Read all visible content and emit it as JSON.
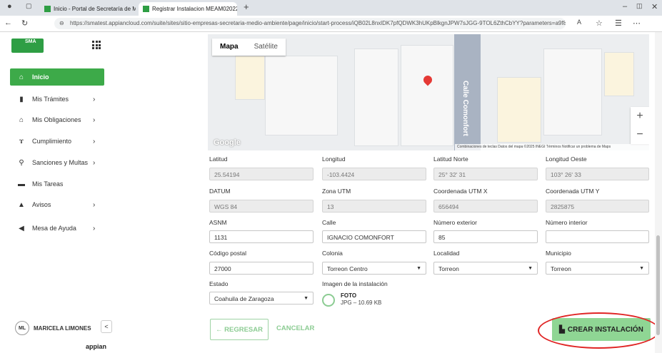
{
  "browser": {
    "tabs": [
      {
        "label": "Inicio - Portal de Secretaría de M "
      },
      {
        "label": "Registrar Instalacion MEAM02022"
      }
    ],
    "new_tab": "+",
    "url": "https://smatest.appiancloud.com/suite/sites/sitio-empresas-secretaria-medio-ambiente/page/inicio/start-process/iQB02L8nxlDK7pfQDWK3hUKpBlkgnJPW7sJGG-9TOL6ZthCbYY?parameters=a9f81..."
  },
  "sidebar": {
    "logo_text": "SMA",
    "items": [
      {
        "label": "Inicio",
        "icon": "home-icon",
        "glyph": "⌂"
      },
      {
        "label": "Mis Trámites",
        "icon": "document-icon",
        "glyph": "▮"
      },
      {
        "label": "Mis Obligaciones",
        "icon": "institution-icon",
        "glyph": "⌂"
      },
      {
        "label": "Cumplimiento",
        "icon": "award-icon",
        "glyph": "ɤ"
      },
      {
        "label": "Sanciones y Multas",
        "icon": "search-person-icon",
        "glyph": "⚲"
      },
      {
        "label": "Mis Tareas",
        "icon": "briefcase-icon",
        "glyph": "▬"
      },
      {
        "label": "Avisos",
        "icon": "warning-icon",
        "glyph": "▲"
      },
      {
        "label": "Mesa de Ayuda",
        "icon": "megaphone-icon",
        "glyph": "◀"
      }
    ],
    "chevron": "›",
    "user_initials": "ML",
    "user_name": "MARICELA LIMONES",
    "collapse": "<",
    "footer": "appian"
  },
  "map": {
    "tab_map": "Mapa",
    "tab_satellite": "Satélite",
    "street": "Calle Comonfort",
    "zoom_in": "+",
    "zoom_out": "−",
    "google": "Google",
    "attribution": "Combinaciones de teclas   Datos del mapa ©2025 INEGI   Términos   Notificar un problema de Maps"
  },
  "form": {
    "latitud": {
      "label": "Latitud",
      "value": "25.54194"
    },
    "longitud": {
      "label": "Longitud",
      "value": "-103.4424"
    },
    "latitud_norte": {
      "label": "Latitud Norte",
      "value": "25° 32' 31"
    },
    "longitud_oeste": {
      "label": "Longitud Oeste",
      "value": "103° 26' 33"
    },
    "datum": {
      "label": "DATUM",
      "value": "WGS 84"
    },
    "zona_utm": {
      "label": "Zona UTM",
      "value": "13"
    },
    "utm_x": {
      "label": "Coordenada UTM X",
      "value": "656494"
    },
    "utm_y": {
      "label": "Coordenada UTM Y",
      "value": "2825875"
    },
    "asnm": {
      "label": "ASNM",
      "value": "1131"
    },
    "calle": {
      "label": "Calle",
      "value": "IGNACIO COMONFORT"
    },
    "num_ext": {
      "label": "Número exterior",
      "value": "85"
    },
    "num_int": {
      "label": "Número interior",
      "value": ""
    },
    "cp": {
      "label": "Código postal",
      "value": "27000"
    },
    "colonia": {
      "label": "Colonia",
      "value": "Torreon Centro"
    },
    "localidad": {
      "label": "Localidad",
      "value": "Torreon"
    },
    "municipio": {
      "label": "Municipio",
      "value": "Torreon"
    },
    "estado": {
      "label": "Estado",
      "value": "Coahuila de Zaragoza"
    },
    "imagen": {
      "label": "Imagen de la instalación",
      "file_title": "FOTO",
      "file_info": "JPG – 10.69 KB"
    }
  },
  "actions": {
    "back": "← REGRESAR",
    "cancel": "CANCELAR",
    "create": "CREAR INSTALACIÓN"
  }
}
